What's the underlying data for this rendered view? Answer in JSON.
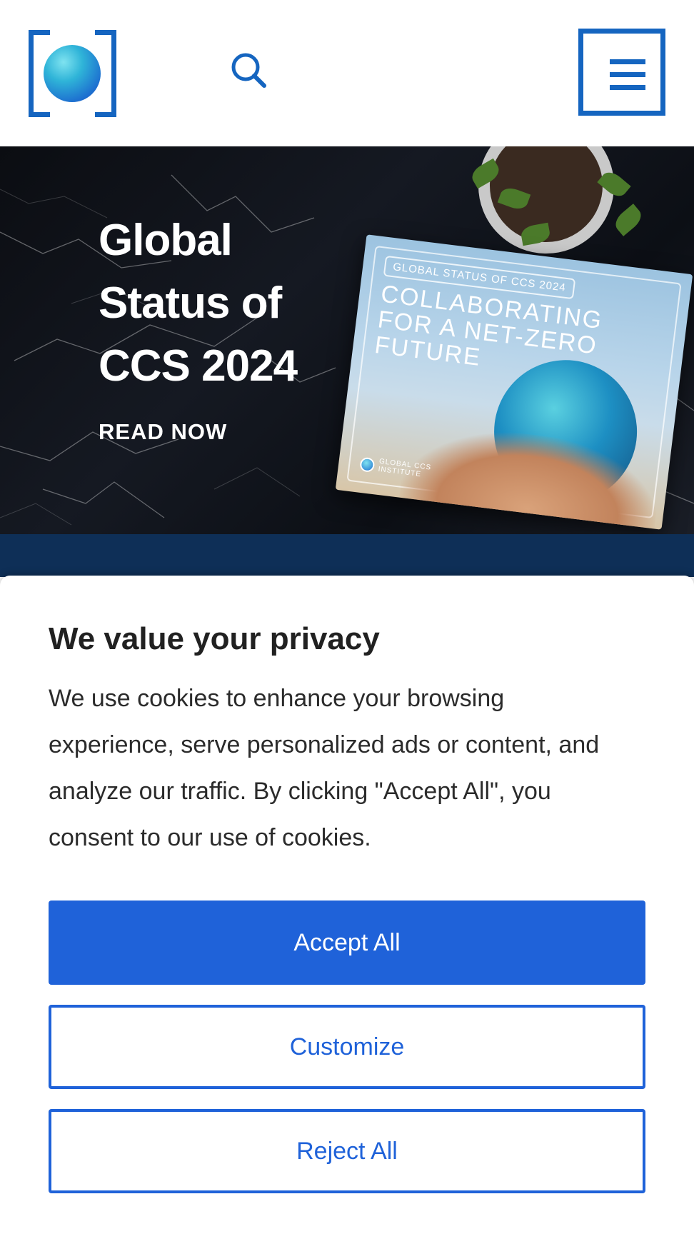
{
  "header": {
    "logo_name": "global-ccs-institute-logo",
    "search_icon": "search-icon",
    "menu_icon": "hamburger-menu-icon",
    "accent_color": "#1565c0"
  },
  "hero": {
    "title_lines": [
      "Global",
      "Status of",
      "CCS 2024"
    ],
    "cta": "READ NOW",
    "report": {
      "tag": "GLOBAL STATUS OF CCS 2024",
      "headline_lines": [
        "COLLABORATING",
        "FOR A NET-ZERO",
        "FUTURE"
      ],
      "publisher_lines": [
        "GLOBAL CCS",
        "INSTITUTE"
      ]
    }
  },
  "cookie": {
    "title": "We value your privacy",
    "body": "We use cookies to enhance your browsing experience, serve personalized ads or content, and analyze our traffic. By clicking \"Accept All\", you consent to our use of cookies.",
    "accept_label": "Accept All",
    "customize_label": "Customize",
    "reject_label": "Reject All",
    "button_color": "#1f62d9"
  }
}
